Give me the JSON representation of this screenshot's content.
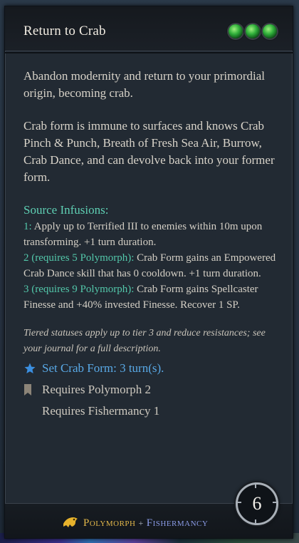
{
  "tooltip": {
    "title": "Return to Crab",
    "action_points": 3,
    "description": [
      "Abandon modernity and return to your primordial origin, becoming crab.",
      "Crab form is immune to surfaces and knows Crab Pinch & Punch, Breath of Fresh Sea Air, Burrow, Crab Dance, and can devolve back into your former form."
    ],
    "infusions": {
      "title": "Source Infusions:",
      "items": [
        {
          "tier": "1:",
          "text": "Apply up to Terrified III to enemies within 10m upon transforming. +1 turn duration."
        },
        {
          "tier": "2 (requires 5 Polymorph):",
          "text": "Crab Form gains an Empowered Crab Dance skill that has 0 cooldown. +1 turn duration."
        },
        {
          "tier": "3 (requires 9 Polymorph):",
          "text": "Crab Form gains Spellcaster Finesse and +40% invested Finesse. Recover 1 SP."
        }
      ]
    },
    "note": "Tiered statuses apply up to tier 3 and reduce resistances; see your journal for a full description.",
    "effect": "Set Crab Form: 3 turn(s).",
    "requirements": [
      "Requires Polymorph 2",
      "Requires Fishermancy 1"
    ],
    "schools": {
      "primary": "Polymorph",
      "separator": "+",
      "secondary": "Fishermancy"
    },
    "cooldown": "6"
  },
  "colors": {
    "accent_teal": "#53c7aa",
    "effect_blue": "#59a9e6",
    "polymorph_gold": "#e3b84a",
    "fishermancy_blue": "#8a9be6"
  }
}
